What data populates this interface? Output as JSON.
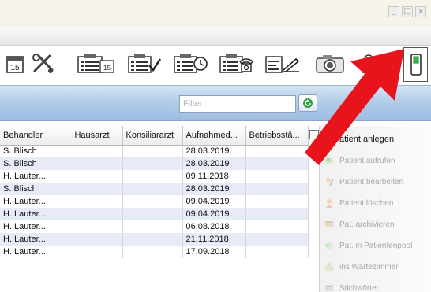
{
  "window": {
    "minimize": "_",
    "maximize": "□",
    "close": "x"
  },
  "toolbar": {
    "icons": [
      {
        "name": "calendar-icon",
        "text": "15"
      },
      {
        "name": "tools-icon",
        "text": ""
      },
      {
        "name": "list-calendar-icon",
        "text": "15"
      },
      {
        "name": "list-check-icon",
        "text": ""
      },
      {
        "name": "list-clock-icon",
        "text": ""
      },
      {
        "name": "list-phone-icon",
        "text": ""
      },
      {
        "name": "list-edit-icon",
        "text": ""
      },
      {
        "name": "camera-icon",
        "text": ""
      },
      {
        "name": "users-lock-icon",
        "text": ""
      },
      {
        "name": "phone-device-icon",
        "text": ""
      }
    ]
  },
  "filter": {
    "placeholder": "Filter"
  },
  "table": {
    "columns": [
      "Behandler",
      "Hausarzt",
      "Konsiliararzt",
      "Aufnahmed...",
      "Betriebsstä..."
    ],
    "rows": [
      [
        "S. Blisch",
        "",
        "",
        "28.03.2019",
        ""
      ],
      [
        "S. Blisch",
        "",
        "",
        "28.03.2019",
        ""
      ],
      [
        "H. Lauter...",
        "",
        "",
        "09.11.2018",
        ""
      ],
      [
        "S. Blisch",
        "",
        "",
        "28.03.2019",
        ""
      ],
      [
        "H. Lauter...",
        "",
        "",
        "09.04.2019",
        ""
      ],
      [
        "H. Lauter...",
        "",
        "",
        "09.04.2019",
        ""
      ],
      [
        "H. Lauter...",
        "",
        "",
        "06.08.2018",
        ""
      ],
      [
        "H. Lauter...",
        "",
        "",
        "21.11.2018",
        ""
      ],
      [
        "H. Lauter...",
        "",
        "",
        "17.09.2018",
        ""
      ]
    ]
  },
  "side_panel": {
    "items": [
      {
        "label": "atient anlegen",
        "active": true
      },
      {
        "label": "Patient aufrufen",
        "active": false
      },
      {
        "label": "Patient bearbeiten",
        "active": false
      },
      {
        "label": "Patient löschen",
        "active": false
      },
      {
        "label": "Pat. archivieren",
        "active": false
      },
      {
        "label": "Pat. in Patientenpool",
        "active": false
      },
      {
        "label": "ins Wartezimmer",
        "active": false
      },
      {
        "label": "Stichwörter",
        "active": false
      }
    ]
  },
  "colors": {
    "arrow": "#e8141b",
    "accent": "#2e9e3a",
    "header_gradient_end": "#9dbde2"
  }
}
